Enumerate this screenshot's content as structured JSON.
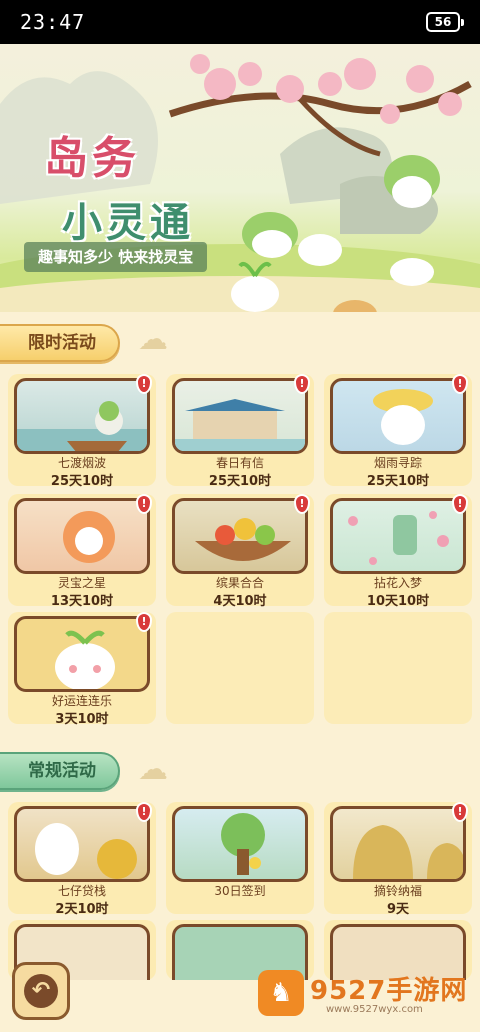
{
  "status_bar": {
    "time": "23:47",
    "battery": "56"
  },
  "banner": {
    "title_line1": "岛务",
    "title_line2": "小灵通",
    "slogan": "趣事知多少  快来找灵宝"
  },
  "sections": {
    "limited": {
      "title": "限时活动",
      "cards": [
        {
          "name": "七渡烟波",
          "time": "25天10时",
          "badge": "!"
        },
        {
          "name": "春日有信",
          "time": "25天10时",
          "badge": "!"
        },
        {
          "name": "烟雨寻踪",
          "time": "25天10时",
          "badge": "!"
        },
        {
          "name": "灵宝之星",
          "time": "13天10时",
          "badge": "!"
        },
        {
          "name": "缤果合合",
          "time": "4天10时",
          "badge": "!"
        },
        {
          "name": "拈花入梦",
          "time": "10天10时",
          "badge": "!"
        },
        {
          "name": "好运连连乐",
          "time": "3天10时",
          "badge": "!"
        }
      ]
    },
    "regular": {
      "title": "常规活动",
      "cards": [
        {
          "name": "七仔贷栈",
          "time": "2天10时",
          "badge": "!"
        },
        {
          "name": "30日签到",
          "time": "",
          "badge": ""
        },
        {
          "name": "摘铃纳福",
          "time": "9天",
          "badge": "!"
        }
      ]
    }
  },
  "watermark": {
    "name": "9527手游网",
    "url": "www.9527wyx.com"
  },
  "icons": {
    "back": "back-arrow-icon",
    "logo": "horse-icon"
  },
  "colors": {
    "background": "#fbf1d4",
    "card": "#fcebb2",
    "card_border": "#7a4a2a",
    "badge": "#d83a3a",
    "title_pink": "#d84e6a",
    "title_green": "#3f8e6e"
  }
}
